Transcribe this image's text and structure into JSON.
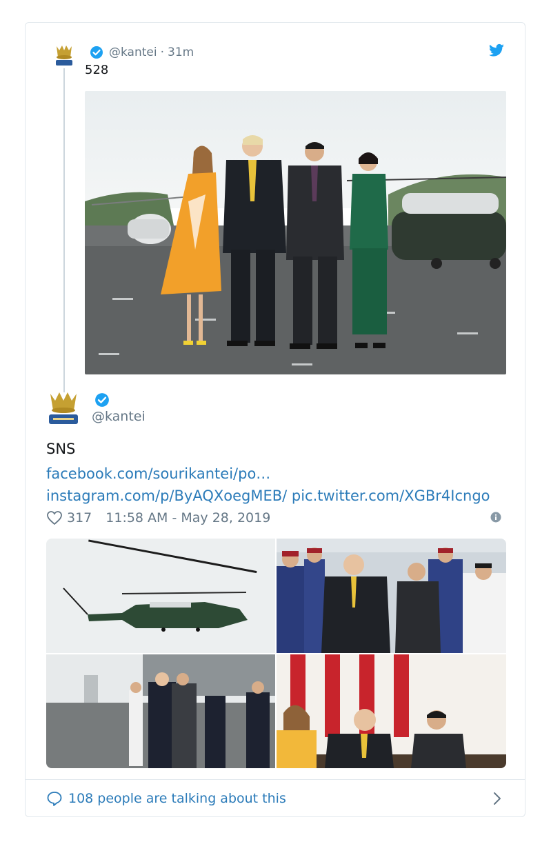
{
  "quoted_tweet": {
    "handle": "@kantei",
    "separator": "·",
    "time": "31m",
    "text": "528"
  },
  "tweet": {
    "handle": "@kantei",
    "text": "SNS",
    "links": [
      "facebook.com/sourikantei/po…",
      "instagram.com/p/ByAQXoegMEB/",
      "pic.twitter.com/XGBr4Icngo"
    ],
    "likes": "317",
    "timestamp": "11:58 AM - May 28, 2019"
  },
  "footer": {
    "label": "108 people are talking about this"
  },
  "icons": {
    "bird": "twitter-bird-icon",
    "verified": "verified-badge-icon",
    "heart": "heart-icon",
    "info": "info-icon",
    "comment": "comment-bubble-icon",
    "chevron": "chevron-right-icon"
  },
  "colors": {
    "link": "#2b7bb9",
    "verified": "#1da1f2",
    "muted": "#657786",
    "border": "#e1e8ed"
  }
}
